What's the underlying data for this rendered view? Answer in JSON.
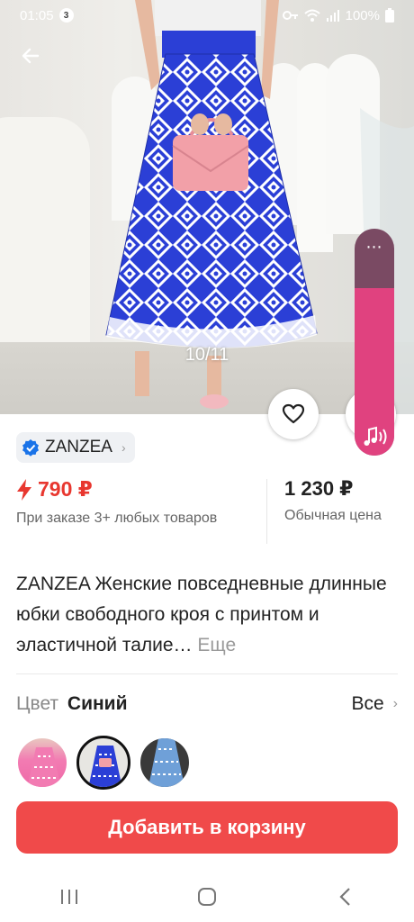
{
  "status_bar": {
    "time": "01:05",
    "notification_count": "3",
    "battery": "100%"
  },
  "hero": {
    "image_counter": "10/11",
    "skirt_colors": {
      "primary": "#2b3fd6",
      "pattern": "#ffffff"
    },
    "bag_color": "#f2a0a8"
  },
  "volume_panel": {
    "level_fraction": 0.74,
    "more_icon": "⋯"
  },
  "seller": {
    "name": "ZANZEA",
    "verified_icon": "verified-check-icon"
  },
  "prices": {
    "sale_price": "790 ₽",
    "sale_note": "При заказе 3+ любых товаров",
    "regular_price": "1 230 ₽",
    "regular_note": "Обычная цена",
    "accent_color": "#e8372f"
  },
  "product": {
    "title": "ZANZEA Женские повседневные длинные юбки свободного кроя с принтом и эластичной талие…",
    "more_label": "Еще"
  },
  "color_selector": {
    "label": "Цвет",
    "selected_value": "Синий",
    "all_label": "Все",
    "swatches": [
      {
        "name": "pink",
        "color": "#f27bb2"
      },
      {
        "name": "blue",
        "color": "#2b3fd6",
        "selected": true
      },
      {
        "name": "light-blue",
        "color": "#6fa0d8"
      }
    ]
  },
  "cart_button": {
    "label": "Добавить в корзину",
    "color": "#f04a4a"
  }
}
